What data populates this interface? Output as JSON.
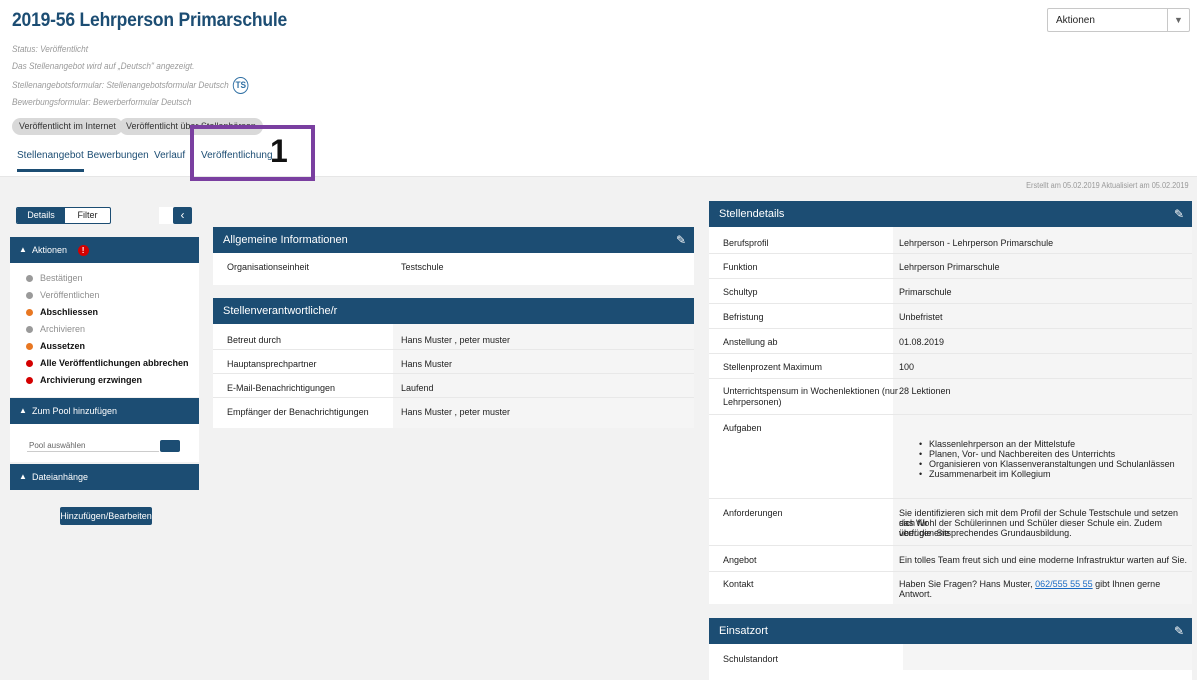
{
  "header": {
    "title": "2019-56 Lehrperson Primarschule",
    "actions_label": "Aktionen",
    "meta": {
      "status": "Status: Veröffentlicht",
      "language": "Das Stellenangebot wird auf „Deutsch\" angezeigt.",
      "form": "Stellenangebotsformular: Stellenangebotsformular Deutsch",
      "form_badge": "TS",
      "application_form": "Bewerbungsformular: Bewerberformular Deutsch"
    },
    "pills": [
      "Veröffentlicht im Internet",
      "Veröffentlicht über Stellenbörsen"
    ]
  },
  "tabs": [
    "Stellenangebot",
    "Bewerbungen",
    "Verlauf",
    "Veröffentlichung"
  ],
  "highlight_number": "1",
  "created_info": "Erstellt am 05.02.2019 Aktualisiert am 05.02.2019",
  "sidebar": {
    "toggle": [
      "Details",
      "Filter"
    ],
    "collapse_icon": "‹",
    "actions_title": "Aktionen",
    "actions_alert": "!",
    "actions": [
      {
        "label": "Bestätigen",
        "style": "grey",
        "dot": "#9a9a9a"
      },
      {
        "label": "Veröffentlichen",
        "style": "grey",
        "dot": "#9a9a9a"
      },
      {
        "label": "Abschliessen",
        "style": "bold",
        "dot": "#e87722"
      },
      {
        "label": "Archivieren",
        "style": "grey",
        "dot": "#9a9a9a"
      },
      {
        "label": "Aussetzen",
        "style": "bold",
        "dot": "#e87722"
      },
      {
        "label": "Alle Veröffentlichungen abbrechen",
        "style": "bold",
        "dot": "#d40000"
      },
      {
        "label": "Archivierung erzwingen",
        "style": "bold",
        "dot": "#d40000"
      }
    ],
    "pool_title": "Zum Pool hinzufügen",
    "pool_placeholder": "Pool auswählen",
    "attachments_title": "Dateianhänge",
    "attachments_button": "Hinzufügen/Bearbeiten"
  },
  "general": {
    "title": "Allgemeine Informationen",
    "rows": [
      {
        "key": "Organisationseinheit",
        "value": "Testschule"
      }
    ]
  },
  "responsible": {
    "title": "Stellenverantwortliche/r",
    "rows": [
      {
        "key": "Betreut durch",
        "value": "Hans Muster   ,  peter muster"
      },
      {
        "key": "Hauptansprechpartner",
        "value": "Hans Muster"
      },
      {
        "key": "E-Mail-Benachrichtigungen",
        "value": "Laufend"
      },
      {
        "key": "Empfänger der Benachrichtigungen",
        "value": "Hans Muster   ,  peter muster"
      }
    ]
  },
  "details": {
    "title": "Stellendetails",
    "rows": [
      {
        "key": "Berufsprofil",
        "value": "Lehrperson - Lehrperson Primarschule"
      },
      {
        "key": "Funktion",
        "value": "Lehrperson Primarschule"
      },
      {
        "key": "Schultyp",
        "value": "Primarschule"
      },
      {
        "key": "Befristung",
        "value": "Unbefristet"
      },
      {
        "key": "Anstellung ab",
        "value": "01.08.2019"
      },
      {
        "key": "Stellenprozent Maximum",
        "value": "100"
      }
    ],
    "pensum_key_1": "Unterrichtspensum in Wochenlektionen (nur",
    "pensum_key_2": "Lehrpersonen)",
    "pensum_value": "28 Lektionen",
    "tasks_key": "Aufgaben",
    "tasks": [
      "Klassenlehrperson an der Mittelstufe",
      "Planen, Vor- und Nachbereiten des Unterrichts",
      "Organisieren von Klassenveranstaltungen und Schulanlässen",
      "Zusammenarbeit im Kollegium"
    ],
    "requirements_key": "Anforderungen",
    "requirements_1": "Sie identifizieren sich mit dem Profil der Schule Testschule und setzen sich für",
    "requirements_2": "das Wohl der Schülerinnen und Schüler dieser Schule ein. Zudem verfügen Sie",
    "requirements_3": "über die entsprechendes Grundausbildung.",
    "offer_key": "Angebot",
    "offer_value": "Ein tolles Team freut sich und eine moderne Infrastruktur warten auf Sie.",
    "contact_key": "Kontakt",
    "contact_pre": "Haben Sie Fragen? Hans Muster, ",
    "contact_phone": "062/555 55 55",
    "contact_post": " gibt Ihnen gerne Antwort."
  },
  "location": {
    "title": "Einsatzort",
    "rows": [
      {
        "key": "Schulstandort",
        "value": ""
      }
    ]
  },
  "colors": {
    "primary": "#1c4d73",
    "highlight": "#7a3fa0",
    "alert": "#d40000",
    "warning": "#e87722"
  }
}
